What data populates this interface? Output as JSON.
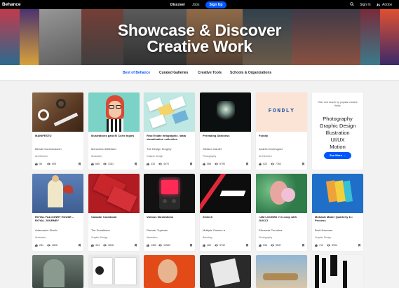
{
  "topbar": {
    "logo": "Behance",
    "discover": "Discover",
    "jobs": "Jobs",
    "signup": "Sign Up",
    "signin": "Sign In",
    "adobe": "Adobe"
  },
  "hero": {
    "title_line1": "Showcase & Discover",
    "title_line2": "Creative Work"
  },
  "tabs": [
    {
      "label": "Best of Behance",
      "active": true
    },
    {
      "label": "Curated Galleries",
      "active": false
    },
    {
      "label": "Creative Tools",
      "active": false
    },
    {
      "label": "Schools & Organizations",
      "active": false
    }
  ],
  "promo": {
    "text": "Filter and search by popular creative fields",
    "fields": [
      "Photography",
      "Graphic Design",
      "Illustration",
      "UI/UX",
      "Motion"
    ],
    "button": "See More"
  },
  "projects": [
    {
      "title": "MANIFESTO",
      "owner": "Bienal Comunicación",
      "field": "Architecture",
      "likes": "56",
      "views": "805"
    },
    {
      "title": "Illustrations para El Corte Inglés",
      "owner": "Mercedes deBellard",
      "field": "Illustration",
      "likes": "665",
      "views": "3161"
    },
    {
      "title": "Real Estate infographic / data visualisation collection",
      "owner": "The Design Surgery",
      "field": "Graphic Design",
      "likes": "433",
      "views": "4070"
    },
    {
      "title": "Pervading Darkness",
      "owner": "Stefano Gardel",
      "field": "Photography",
      "likes": "568",
      "views": "6790"
    },
    {
      "title": "Fondly",
      "owner": "Andrés Domínguez",
      "field": "Art Direction",
      "likes": "523",
      "views": "7163"
    },
    {
      "title": "ROYAL FALCONRY HOUSE – ROYAL JOURNEY",
      "owner": "Adamastor Studio",
      "field": "Illustration",
      "likes": "281",
      "views": "2826"
    },
    {
      "title": "Cazador Cookbook",
      "owner": "Tim Donaldson",
      "field": "Graphic Design",
      "likes": "304",
      "views": "3628"
    },
    {
      "title": "Various Illustrations",
      "owner": "Ramain Trystram",
      "field": "Illustration",
      "likes": "1360",
      "views": "10553"
    },
    {
      "title": "Zintech",
      "owner": "Multiple Owners",
      "field": "Branding",
      "likes": "469",
      "views": "6732"
    },
    {
      "title": "I AM LOCKED // in coop with GUCCI",
      "owner": "Elizaveta Porodina",
      "field": "Photography",
      "likes": "536",
      "views": "5637"
    },
    {
      "title": "Mohawk Maker Quarterly 11: Process",
      "owner": "Brett Newman",
      "field": "Graphic Design",
      "likes": "710",
      "views": "5992"
    }
  ],
  "colors": {
    "accent": "#0057ff",
    "topbar": "#000000"
  }
}
